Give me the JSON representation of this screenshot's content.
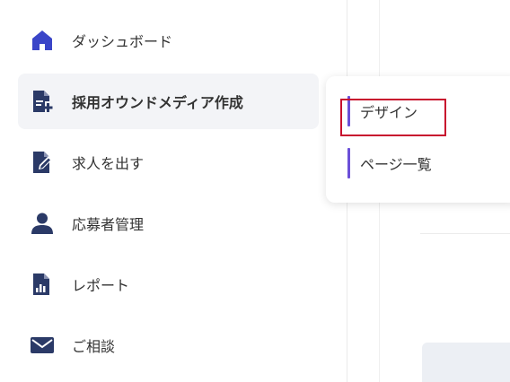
{
  "sidebar": {
    "items": [
      {
        "label": "ダッシュボード",
        "icon": "home-icon"
      },
      {
        "label": "採用オウンドメディア作成",
        "icon": "document-add-icon"
      },
      {
        "label": "求人を出す",
        "icon": "edit-document-icon"
      },
      {
        "label": "応募者管理",
        "icon": "user-icon"
      },
      {
        "label": "レポート",
        "icon": "report-chart-icon"
      },
      {
        "label": "ご相談",
        "icon": "mail-icon"
      }
    ]
  },
  "submenu": {
    "items": [
      {
        "label": "デザイン"
      },
      {
        "label": "ページ一覧"
      }
    ]
  },
  "colors": {
    "icon_navy": "#2b3a67",
    "home_icon": "#3a45c8",
    "accent_purple": "#6b4fd8",
    "highlight_red": "#c8102e",
    "active_bg": "#f3f4f7"
  }
}
